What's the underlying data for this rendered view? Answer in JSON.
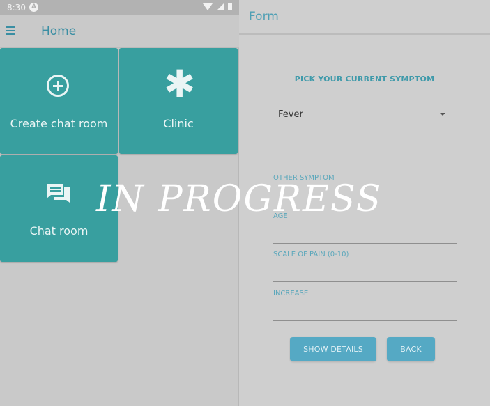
{
  "left_screen": {
    "status_bar": {
      "time": "8:30",
      "badge": "A"
    },
    "app_bar": {
      "title": "Home",
      "menu_icon": "hamburger-menu-icon"
    },
    "tiles": [
      {
        "label": "Create chat room",
        "icon": "add-circle-icon"
      },
      {
        "label": "Clinic",
        "icon": "asterisk-icon"
      },
      {
        "label": "Chat room",
        "icon": "chat-bubbles-icon"
      }
    ]
  },
  "right_screen": {
    "app_bar": {
      "title": "Form"
    },
    "heading": "PICK YOUR CURRENT SYMPTOM",
    "symptom_select": {
      "value": "Fever"
    },
    "fields": [
      {
        "label": "OTHER SYMPTOM"
      },
      {
        "label": "AGE"
      },
      {
        "label": "SCALE OF PAIN (0-10)"
      },
      {
        "label": "INCREASE"
      }
    ],
    "buttons": {
      "show_details": "SHOW DETAILS",
      "back": "BACK"
    }
  },
  "overlay": {
    "text": "IN PROGRESS"
  },
  "colors": {
    "accent": "#389f9f",
    "title_blue": "#3a8ea3",
    "button_blue": "#55a9c4"
  }
}
